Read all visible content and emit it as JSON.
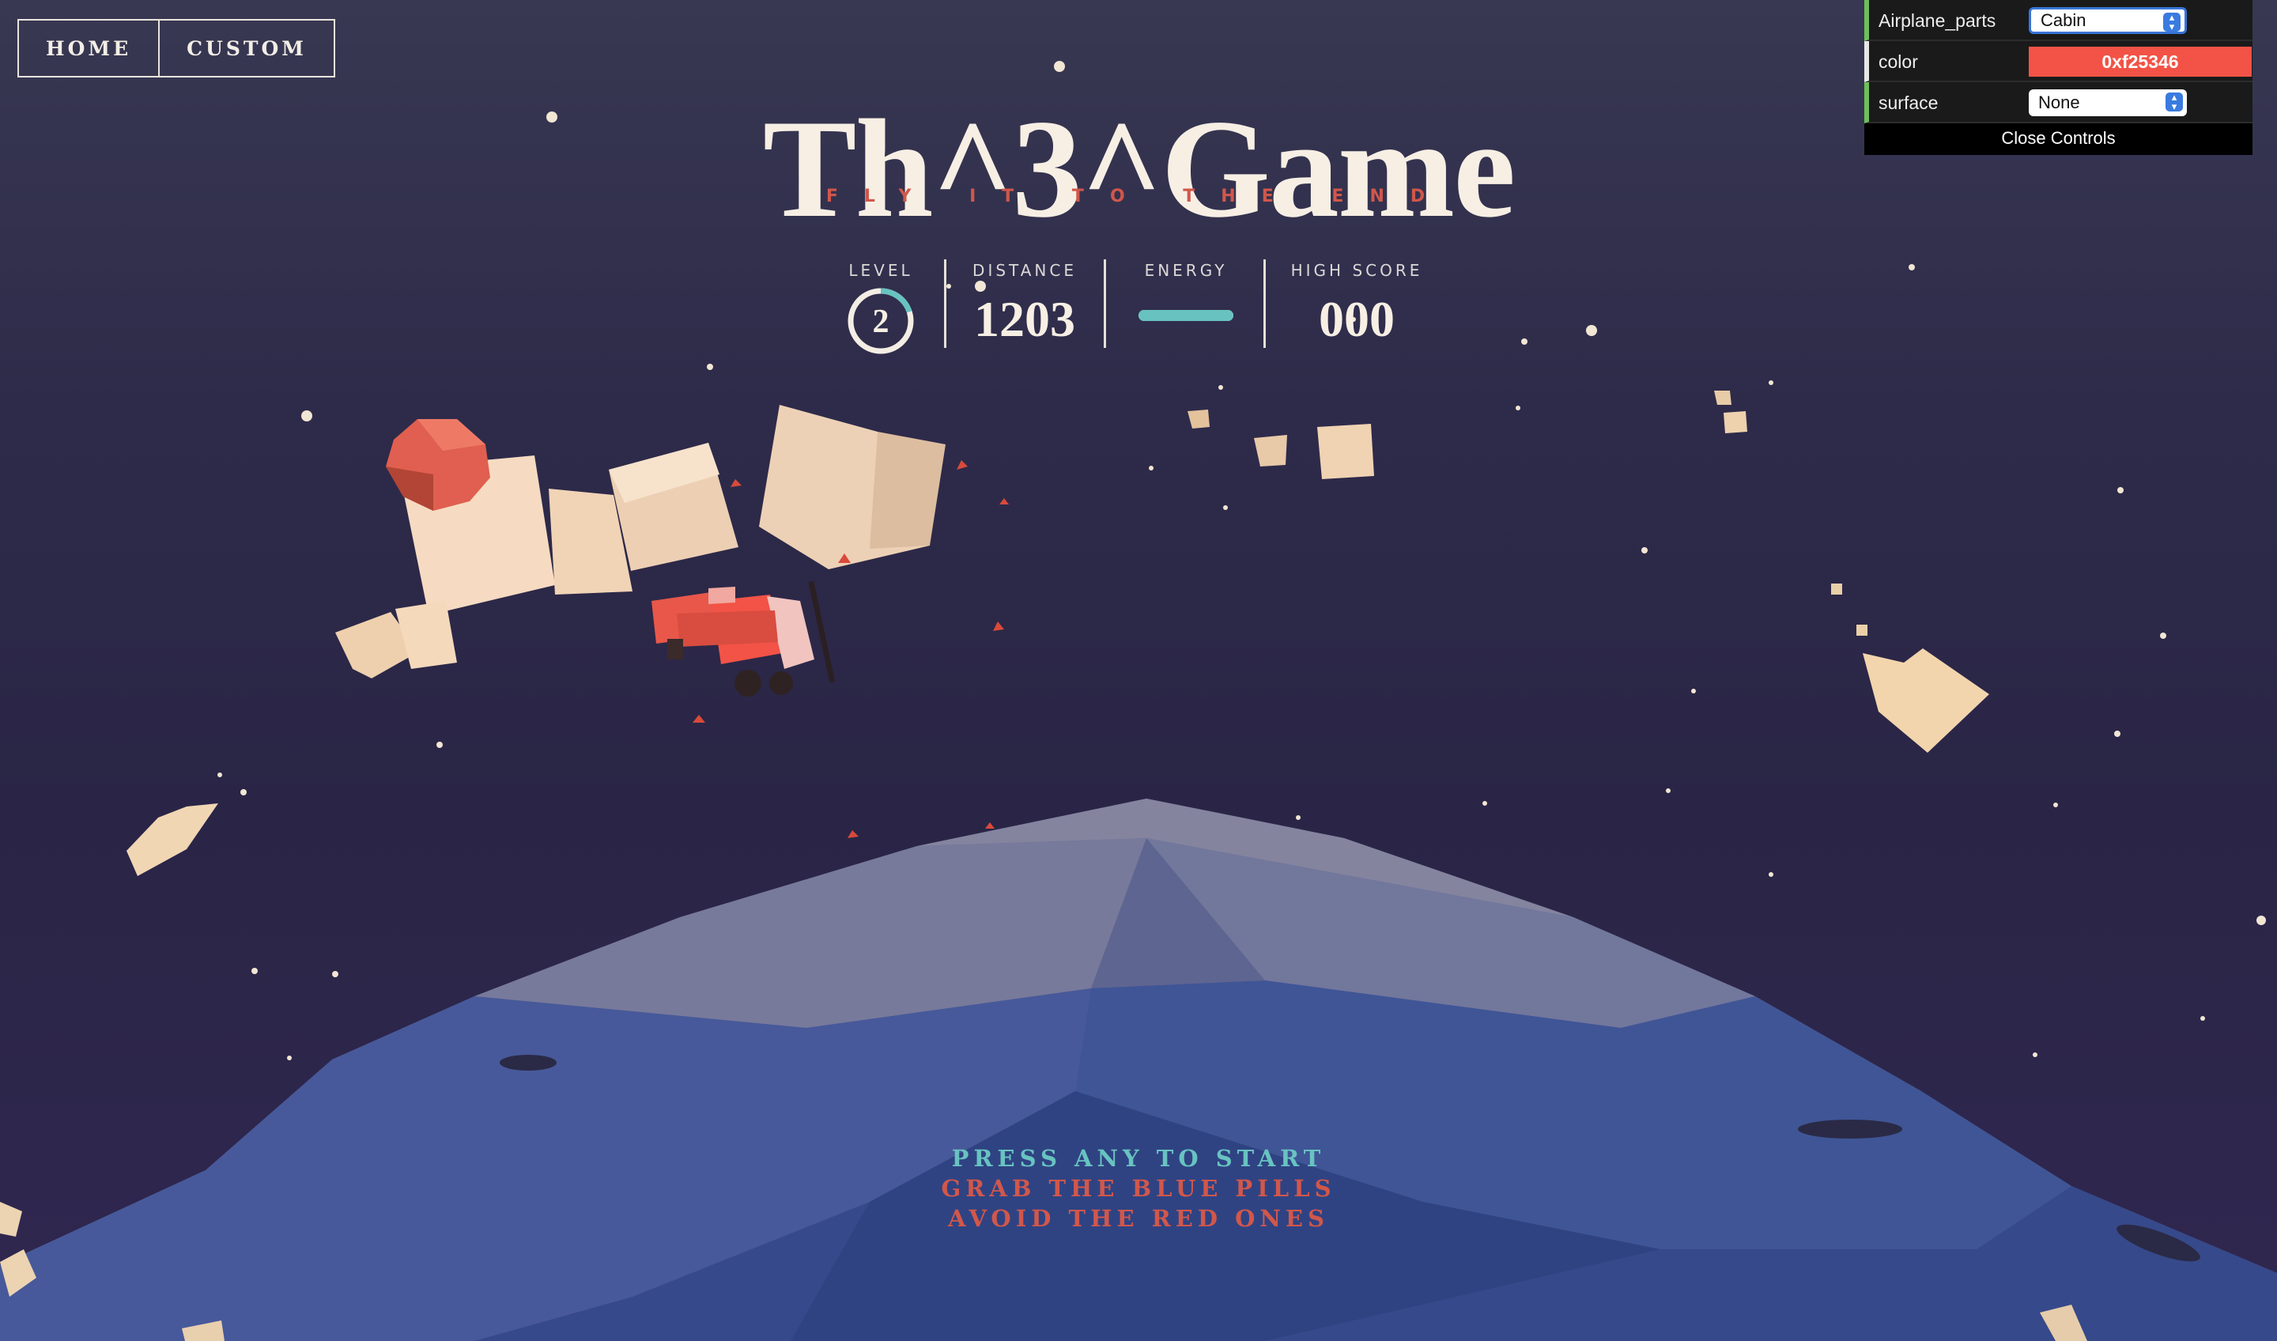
{
  "nav": {
    "home": "HOME",
    "custom": "CUSTOM"
  },
  "title": "Th^3^Game",
  "subtitle": "FLY IT TO THE END",
  "hud": {
    "level_label": "LEVEL",
    "level": "2",
    "level_progress": 0.2,
    "distance_label": "DISTANCE",
    "distance": "1203",
    "energy_label": "ENERGY",
    "energy": 1.0,
    "highscore_label": "HIGH SCORE",
    "highscore": "000"
  },
  "instructions": {
    "press": "PRESS ANY TO START",
    "grab": "GRAB THE BLUE PILLS",
    "avoid": "AVOID THE RED ONES"
  },
  "colors": {
    "accent_red": "#d1574b",
    "accent_teal": "#68c3c0",
    "plane_color": "#f25346",
    "sky_top": "#383852",
    "cream": "#f7efe4"
  },
  "gui": {
    "parts_label": "Airplane_parts",
    "parts_value": "Cabin",
    "color_label": "color",
    "color_value": "0xf25346",
    "surface_label": "surface",
    "surface_value": "None",
    "close_label": "Close Controls"
  }
}
